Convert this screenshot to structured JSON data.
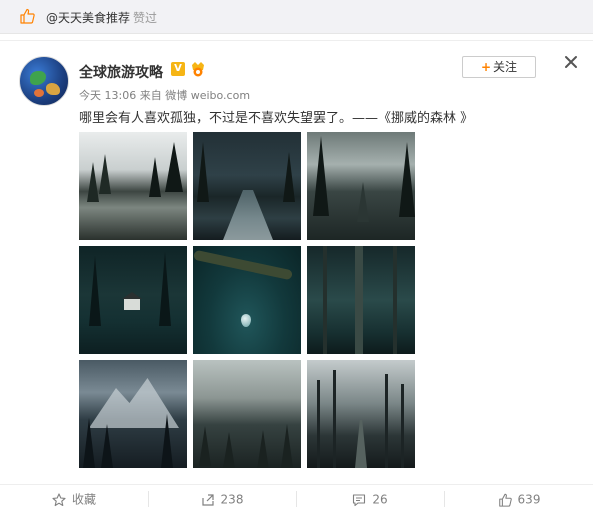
{
  "banner": {
    "user": "@天天美食推荐",
    "action": "赞过"
  },
  "post": {
    "author": "全球旅游攻略",
    "verified_badge": "V",
    "time": "今天 13:06",
    "source_prefix": "来自",
    "source": "微博 weibo.com",
    "text": "哪里会有人喜欢孤独，不过是不喜欢失望罢了。——《挪威的森林 》",
    "follow_label": "关注",
    "images": [
      "misty-lake-forest",
      "forest-river",
      "foggy-mountain-pines",
      "forest-cabin",
      "water-droplet-branch",
      "dark-forest-tree",
      "misty-mountains",
      "foggy-valley-forest",
      "misty-forest-path"
    ]
  },
  "actions": {
    "favorite_label": "收藏",
    "repost_count": "238",
    "comment_count": "26",
    "like_count": "639"
  },
  "colors": {
    "accent": "#ff8200",
    "badge": "#f6b515",
    "muted": "#808080"
  }
}
